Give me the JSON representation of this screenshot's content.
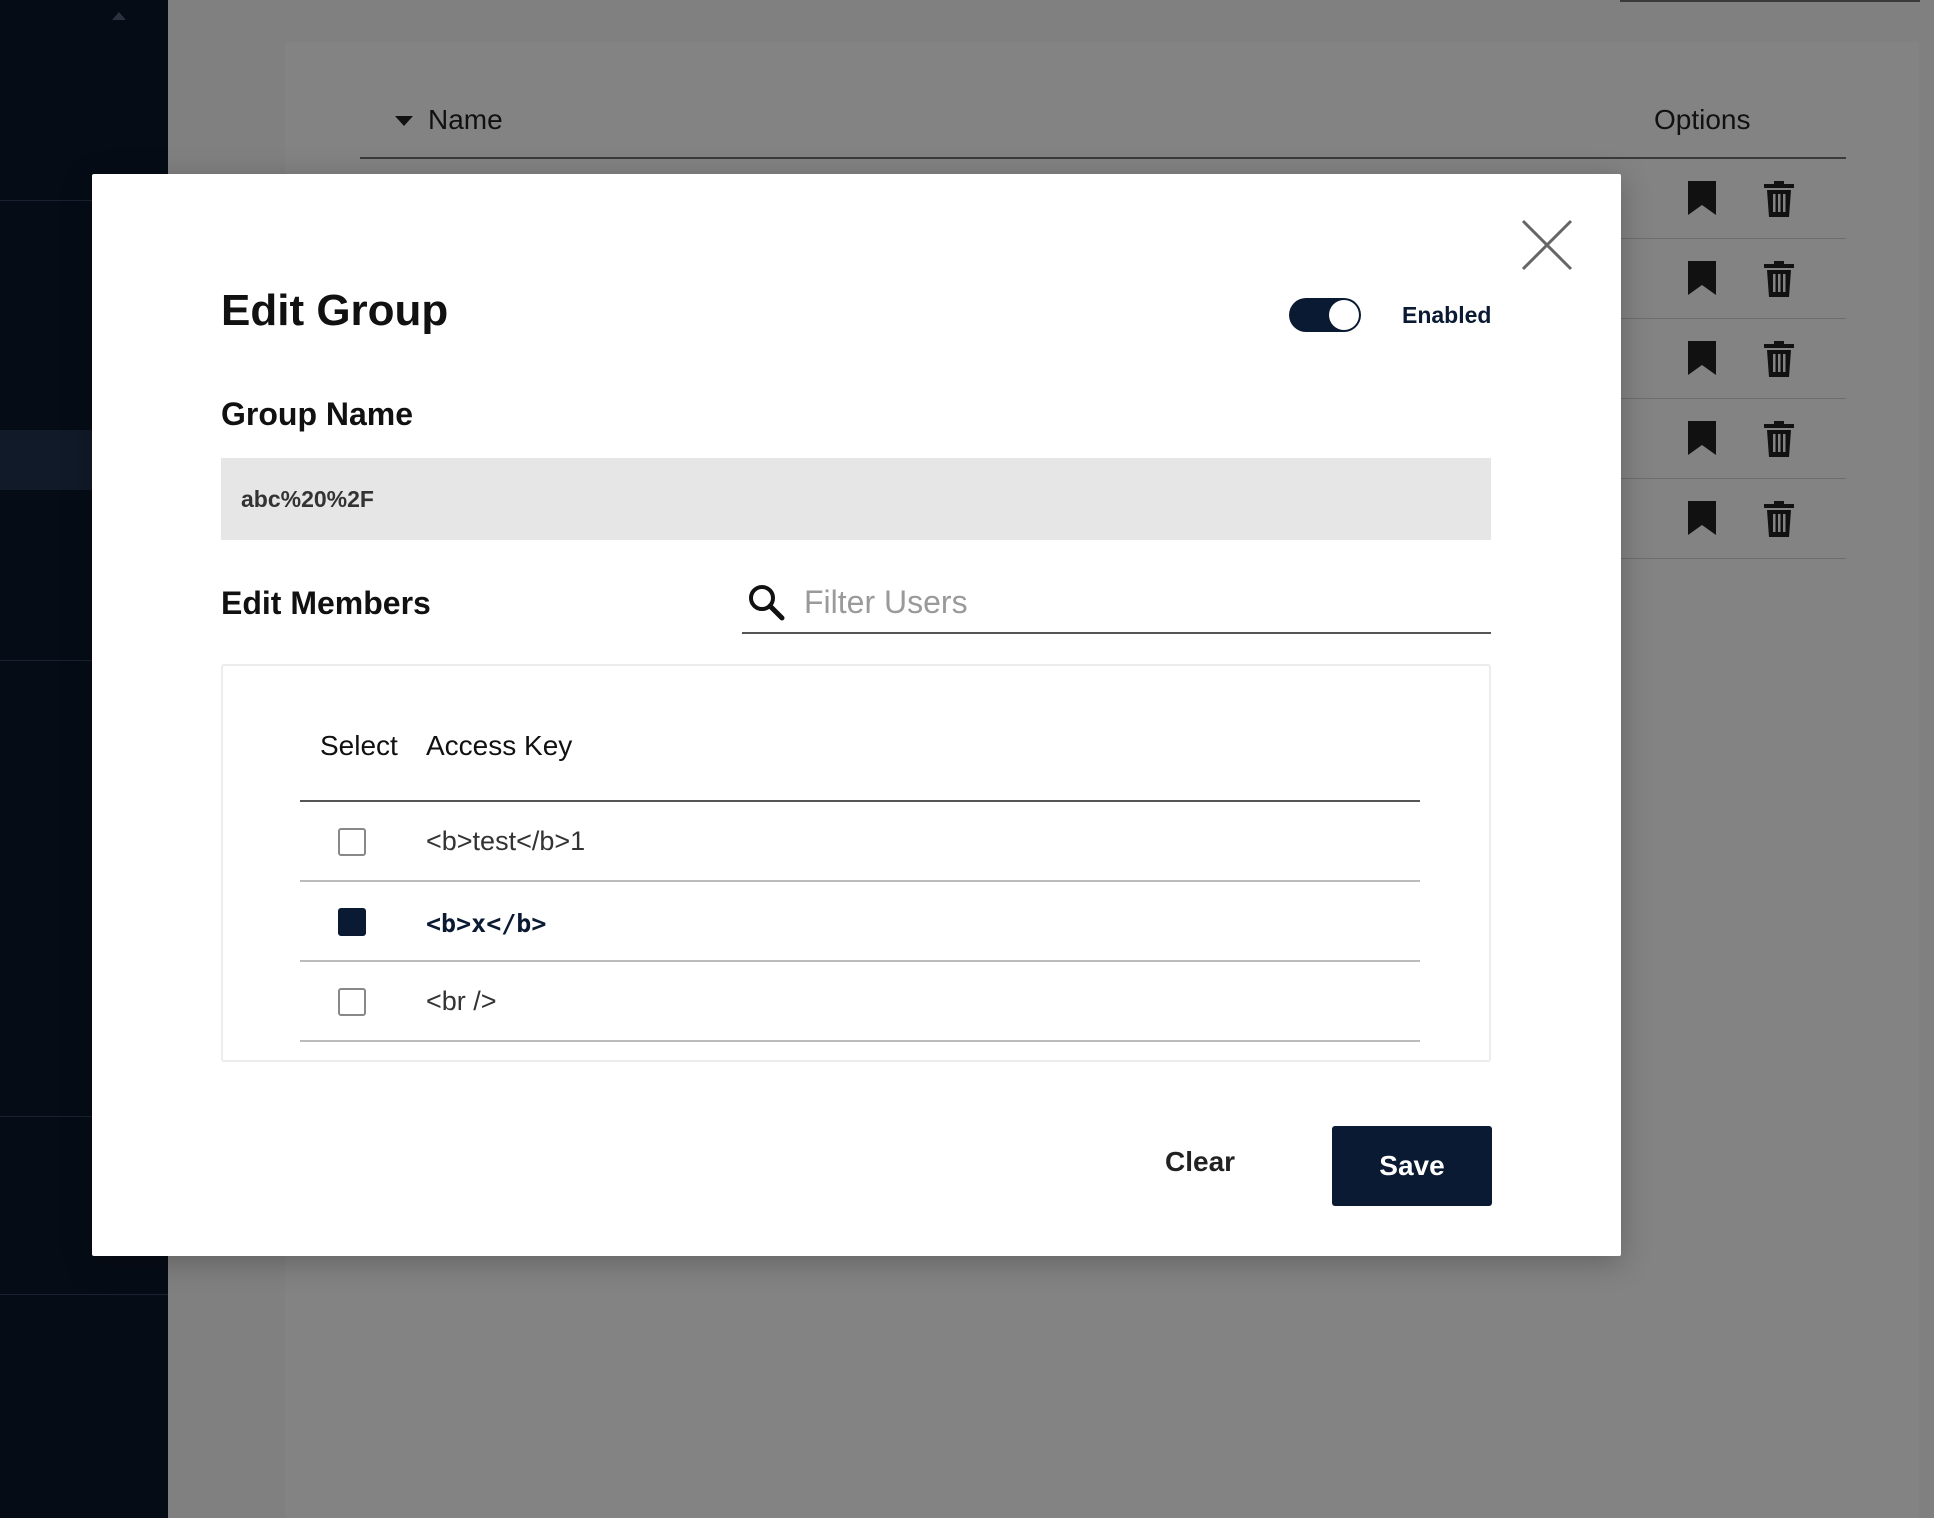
{
  "background": {
    "table": {
      "col_name": "Name",
      "col_options": "Options",
      "row_count": 5
    }
  },
  "modal": {
    "title": "Edit Group",
    "enabled_label": "Enabled",
    "enabled": true,
    "group_name_label": "Group Name",
    "group_name_value": "abc%20%2F",
    "edit_members_label": "Edit Members",
    "filter_placeholder": "Filter Users",
    "members_table": {
      "col_select": "Select",
      "col_access_key": "Access Key",
      "rows": [
        {
          "key": "<b>test</b>1",
          "selected": false
        },
        {
          "key": "<b>x</b>",
          "selected": true
        },
        {
          "key": "<br />",
          "selected": false
        }
      ]
    },
    "clear_label": "Clear",
    "save_label": "Save"
  },
  "colors": {
    "primary": "#0b1a33",
    "sidebar": "#060c16",
    "overlay": "#808080"
  },
  "icons": [
    "close-icon",
    "search-icon",
    "bookmark-icon",
    "trash-icon",
    "sort-caret-icon"
  ]
}
